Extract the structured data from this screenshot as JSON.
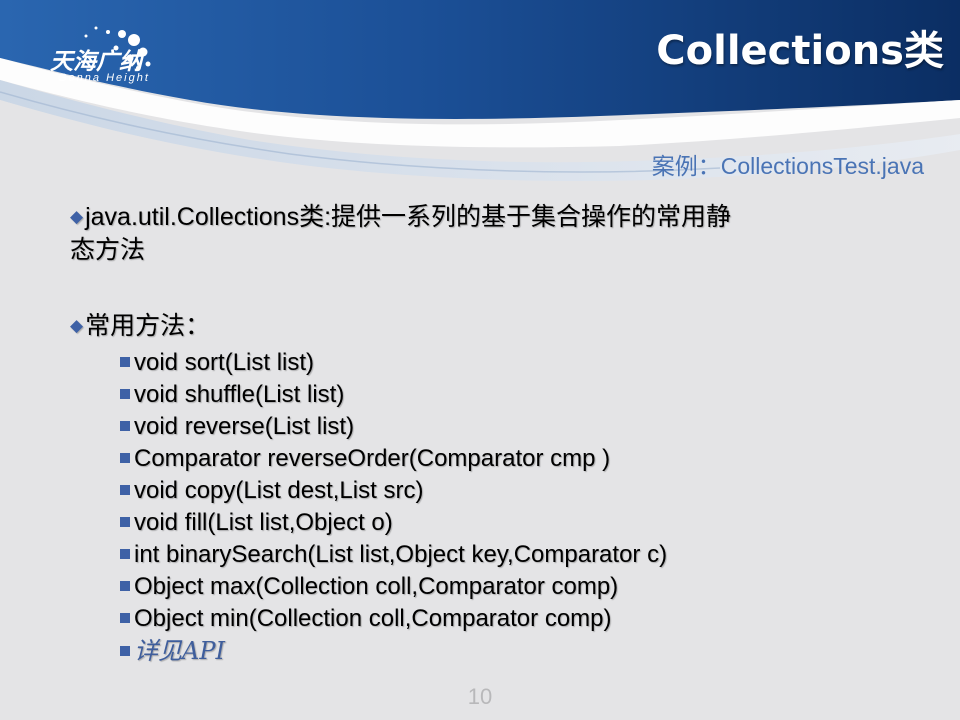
{
  "header": {
    "title": "Collections类",
    "logo_cn": "天海广纳",
    "logo_en": "Gonna Height"
  },
  "example": "案例：CollectionsTest.java",
  "intro": {
    "line1": "java.util.Collections类:提供一系列的基于集合操作的常用静",
    "line2": "态方法"
  },
  "methods_heading": "常用方法：",
  "methods": [
    "void sort(List list)",
    "void shuffle(List list)",
    "void reverse(List list)",
    "Comparator  reverseOrder(Comparator  cmp )",
    "void copy(List dest,List src)",
    "void fill(List list,Object  o)",
    "int binarySearch(List list,Object key,Comparator c)",
    "Object max(Collection coll,Comparator comp)",
    "Object min(Collection coll,Comparator comp)",
    "详见API"
  ],
  "page_number": "10",
  "colors": {
    "header_dark": "#0b2e63",
    "header_mid": "#1f5aa3",
    "accent": "#3e61a6",
    "example_text": "#4a74b5"
  }
}
